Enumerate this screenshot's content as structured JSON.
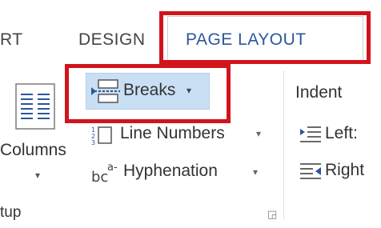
{
  "tabs": {
    "partial_left": "RT",
    "design": "DESIGN",
    "page_layout": "PAGE LAYOUT"
  },
  "page_setup": {
    "columns_label": "Columns",
    "breaks_label": "Breaks",
    "line_numbers_label": "Line Numbers",
    "hyphenation_label": "Hyphenation",
    "group_label_partial": "tup"
  },
  "paragraph": {
    "indent_label": "Indent",
    "left_label": "Left:",
    "right_label": "Right"
  },
  "colors": {
    "highlight": "#d1141b",
    "active_tab_text": "#2b579a",
    "hover_fill": "#c9dff3"
  }
}
